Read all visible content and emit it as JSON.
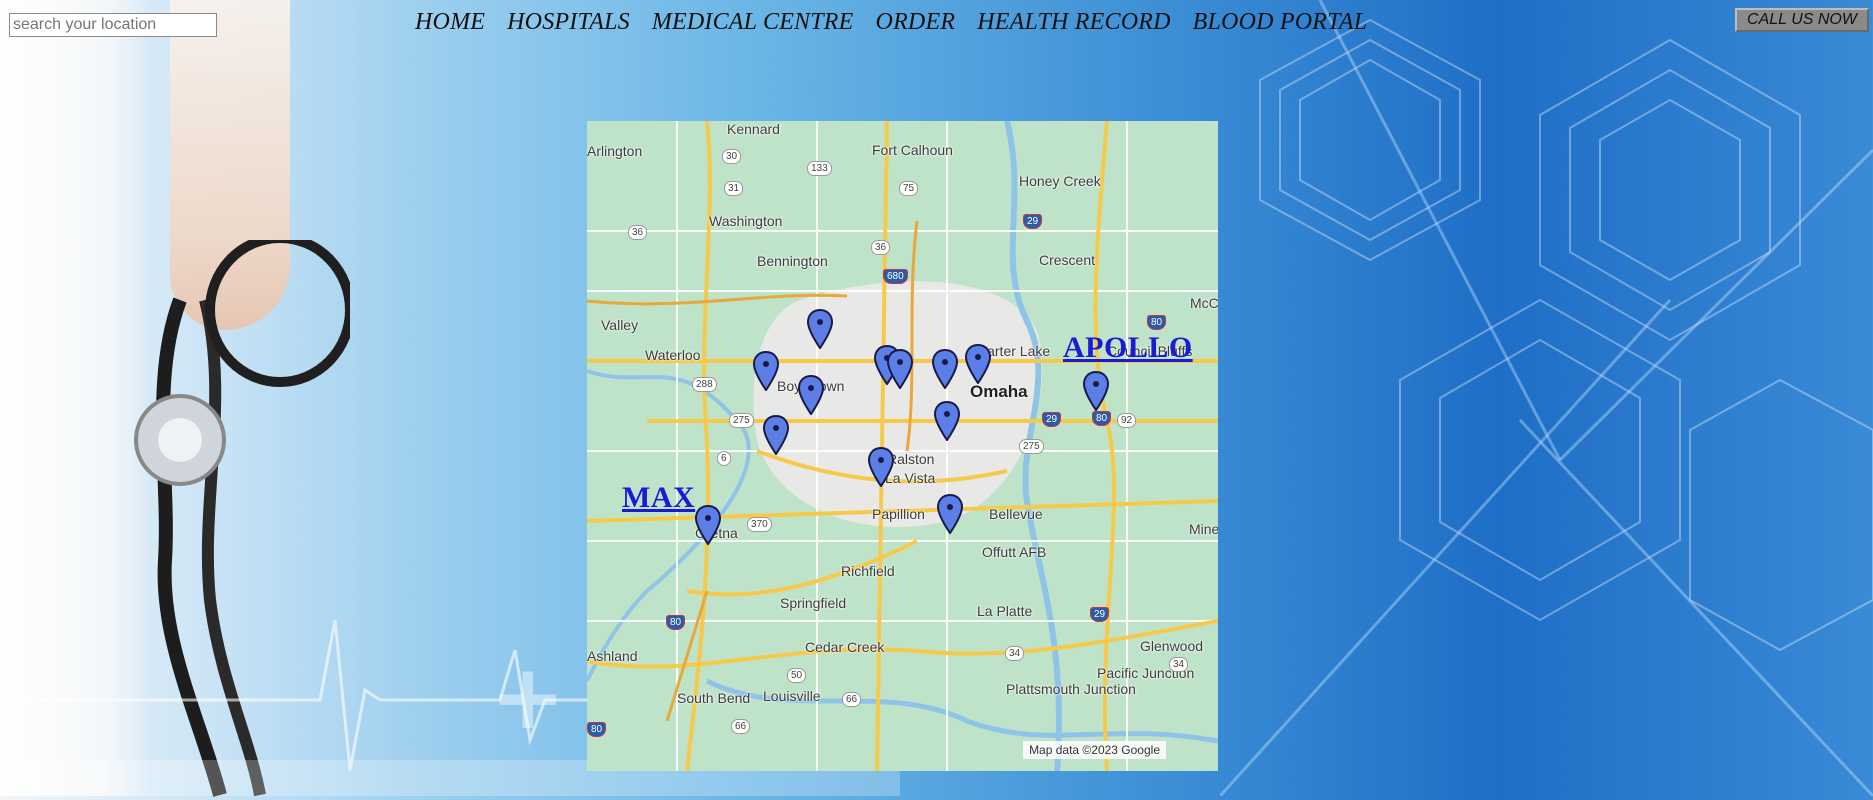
{
  "search": {
    "placeholder": "search your location",
    "value": ""
  },
  "nav": {
    "items": [
      {
        "id": "home",
        "label": "HOME"
      },
      {
        "id": "hospitals",
        "label": "HOSPITALS"
      },
      {
        "id": "medical-centre",
        "label": "MEDICAL CENTRE"
      },
      {
        "id": "order",
        "label": "ORDER"
      },
      {
        "id": "health-record",
        "label": "HEALTH RECORD"
      },
      {
        "id": "blood-portal",
        "label": "BLOOD PORTAL"
      }
    ]
  },
  "call_button": {
    "label": "CALL US NOW"
  },
  "map": {
    "attribution": "Map data ©2023 Google",
    "places": [
      "Kennard",
      "Arlington",
      "Fort Calhoun",
      "Honey Creek",
      "Washington",
      "Bennington",
      "Crescent",
      "Valley",
      "Waterloo",
      "Boys Town",
      "Carter Lake",
      "Omaha",
      "Council Bluffs",
      "Ralston",
      "La Vista",
      "Papillion",
      "Bellevue",
      "Gretna",
      "Offutt AFB",
      "Richfield",
      "Springfield",
      "La Platte",
      "Cedar Creek",
      "Glenwood",
      "Pacific Junction",
      "Ashland",
      "South Bend",
      "Louisville",
      "Plattsmouth Junction",
      "McC",
      "Mine"
    ],
    "route_shields": [
      "30",
      "133",
      "75",
      "31",
      "36",
      "36",
      "680",
      "29",
      "80",
      "288",
      "275",
      "6",
      "80",
      "92",
      "29",
      "275",
      "370",
      "80",
      "34",
      "50",
      "66",
      "80",
      "34",
      "66",
      "29"
    ],
    "hospitals": [
      {
        "name": "APOLLO"
      },
      {
        "name": "MAX"
      }
    ],
    "pin_color": "#5b7fe6"
  }
}
